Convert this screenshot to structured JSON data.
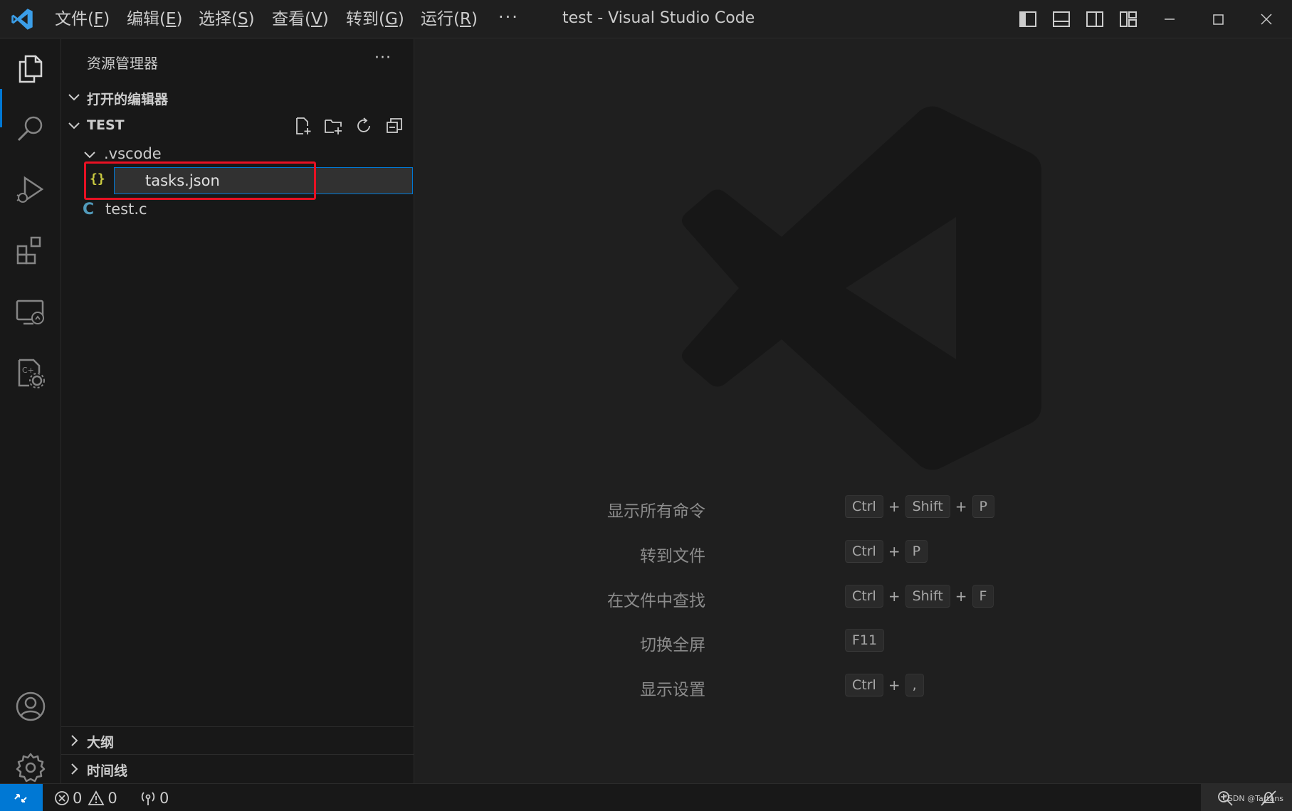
{
  "titlebar": {
    "menus": [
      {
        "label": "文件(",
        "key": "F",
        "end": ")"
      },
      {
        "label": "编辑(",
        "key": "E",
        "end": ")"
      },
      {
        "label": "选择(",
        "key": "S",
        "end": ")"
      },
      {
        "label": "查看(",
        "key": "V",
        "end": ")"
      },
      {
        "label": "转到(",
        "key": "G",
        "end": ")"
      },
      {
        "label": "运行(",
        "key": "R",
        "end": ")"
      }
    ],
    "more": "···",
    "title": "test - Visual Studio Code"
  },
  "sidebar": {
    "title": "资源管理器",
    "more": "···",
    "open_editors": "打开的编辑器",
    "folder": "TEST",
    "tree": {
      "folder_vscode": ".vscode",
      "rename_value": "tasks.json",
      "json_icon": "{}",
      "file_c": "test.c",
      "c_icon": "C"
    },
    "outline": "大纲",
    "timeline": "时间线"
  },
  "editor": {
    "shortcuts": [
      {
        "label": "显示所有命令",
        "keys": [
          "Ctrl",
          "Shift",
          "P"
        ]
      },
      {
        "label": "转到文件",
        "keys": [
          "Ctrl",
          "P"
        ]
      },
      {
        "label": "在文件中查找",
        "keys": [
          "Ctrl",
          "Shift",
          "F"
        ]
      },
      {
        "label": "切换全屏",
        "keys": [
          "F11"
        ]
      },
      {
        "label": "显示设置",
        "keys": [
          "Ctrl",
          ","
        ]
      }
    ],
    "plus": "+"
  },
  "statusbar": {
    "errors": "0",
    "warnings": "0",
    "ports": "0",
    "watermark": "CSDN @Tartans"
  },
  "colors": {
    "accent": "#0078d4",
    "highlight": "#e81123",
    "json_icon": "#cbcb41",
    "c_icon": "#519aba"
  }
}
